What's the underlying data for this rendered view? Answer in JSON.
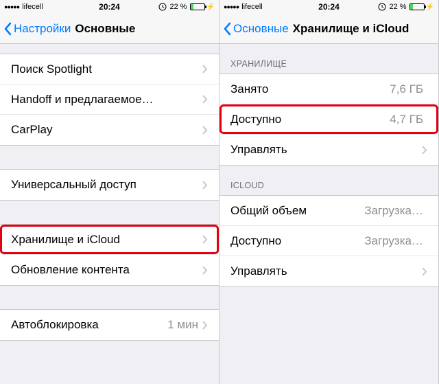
{
  "status": {
    "carrier": "lifecell",
    "time": "20:24",
    "battery_pct": "22 %"
  },
  "left": {
    "back_label": "Настройки",
    "title": "Основные",
    "rows": {
      "spotlight": "Поиск Spotlight",
      "handoff": "Handoff и предлагаемое…",
      "carplay": "CarPlay",
      "accessibility": "Универсальный доступ",
      "storage": "Хранилище и iCloud",
      "refresh": "Обновление контента",
      "autolock_label": "Автоблокировка",
      "autolock_value": "1 мин"
    }
  },
  "right": {
    "back_label": "Основные",
    "title": "Хранилище и iCloud",
    "section_storage": "ХРАНИЛИЩЕ",
    "section_icloud": "ICLOUD",
    "rows": {
      "used_label": "Занято",
      "used_value": "7,6 ГБ",
      "avail_label": "Доступно",
      "avail_value": "4,7 ГБ",
      "manage": "Управлять",
      "ic_total_label": "Общий объем",
      "ic_total_value": "Загрузка…",
      "ic_avail_label": "Доступно",
      "ic_avail_value": "Загрузка…",
      "ic_manage": "Управлять"
    }
  }
}
